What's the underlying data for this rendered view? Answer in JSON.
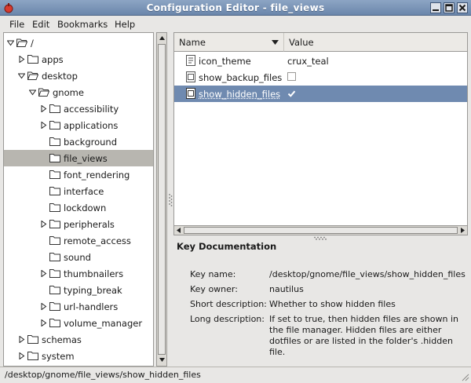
{
  "window": {
    "title": "Configuration Editor - file_views",
    "accent": "#6f8ab0",
    "titlebar_color": "#7a94b8"
  },
  "menu": [
    {
      "label": "File"
    },
    {
      "label": "Edit"
    },
    {
      "label": "Bookmarks"
    },
    {
      "label": "Help"
    }
  ],
  "tree": {
    "items": [
      {
        "label": "/",
        "expanded": true,
        "has_children": true,
        "depth": 0
      },
      {
        "label": "apps",
        "expanded": false,
        "has_children": true,
        "depth": 1
      },
      {
        "label": "desktop",
        "expanded": true,
        "has_children": true,
        "depth": 1
      },
      {
        "label": "gnome",
        "expanded": true,
        "has_children": true,
        "depth": 2
      },
      {
        "label": "accessibility",
        "expanded": false,
        "has_children": true,
        "depth": 3
      },
      {
        "label": "applications",
        "expanded": false,
        "has_children": true,
        "depth": 3
      },
      {
        "label": "background",
        "expanded": false,
        "has_children": false,
        "depth": 3
      },
      {
        "label": "file_views",
        "expanded": false,
        "has_children": false,
        "depth": 3,
        "selected": true
      },
      {
        "label": "font_rendering",
        "expanded": false,
        "has_children": false,
        "depth": 3
      },
      {
        "label": "interface",
        "expanded": false,
        "has_children": false,
        "depth": 3
      },
      {
        "label": "lockdown",
        "expanded": false,
        "has_children": false,
        "depth": 3
      },
      {
        "label": "peripherals",
        "expanded": false,
        "has_children": true,
        "depth": 3
      },
      {
        "label": "remote_access",
        "expanded": false,
        "has_children": false,
        "depth": 3
      },
      {
        "label": "sound",
        "expanded": false,
        "has_children": false,
        "depth": 3
      },
      {
        "label": "thumbnailers",
        "expanded": false,
        "has_children": true,
        "depth": 3
      },
      {
        "label": "typing_break",
        "expanded": false,
        "has_children": false,
        "depth": 3
      },
      {
        "label": "url-handlers",
        "expanded": false,
        "has_children": true,
        "depth": 3
      },
      {
        "label": "volume_manager",
        "expanded": false,
        "has_children": true,
        "depth": 3
      },
      {
        "label": "schemas",
        "expanded": false,
        "has_children": true,
        "depth": 1
      },
      {
        "label": "system",
        "expanded": false,
        "has_children": true,
        "depth": 1
      }
    ]
  },
  "keys": {
    "columns": [
      {
        "label": "Name"
      },
      {
        "label": "Value"
      }
    ],
    "rows": [
      {
        "name": "icon_theme",
        "kind": "string",
        "value": "crux_teal"
      },
      {
        "name": "show_backup_files",
        "kind": "bool",
        "checked": false
      },
      {
        "name": "show_hidden_files",
        "kind": "bool",
        "checked": true,
        "selected": true
      }
    ]
  },
  "doc": {
    "title": "Key Documentation",
    "key_name_label": "Key name:",
    "key_name": "/desktop/gnome/file_views/show_hidden_files",
    "owner_label": "Key owner:",
    "owner": "nautilus",
    "short_label": "Short description:",
    "short": "Whether to show hidden files",
    "long_label": "Long description:",
    "long": "If set to true, then hidden files are shown in the file manager. Hidden files are either dotfiles or are listed in the folder's .hidden file."
  },
  "status": {
    "text": "/desktop/gnome/file_views/show_hidden_files"
  }
}
